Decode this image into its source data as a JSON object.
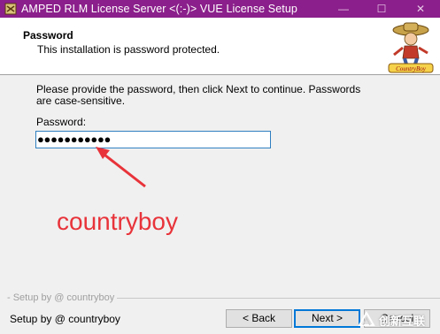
{
  "window": {
    "title": "AMPED RLM License Server <(:-)> VUE License Setup",
    "minimize_glyph": "—",
    "maximize_glyph": "☐",
    "close_glyph": "✕"
  },
  "header": {
    "title": "Password",
    "subtitle": "This installation is password protected.",
    "logo_icon": "countryboy-logo-icon"
  },
  "main": {
    "instructions": "Please provide the password, then click Next to continue. Passwords are case-sensitive.",
    "password_label": "Password:",
    "password_masked": "●●●●●●●●●●●",
    "annotation_text": "countryboy"
  },
  "branding": {
    "text": "- Setup by @ countryboy"
  },
  "footer": {
    "text": "Setup by @ countryboy",
    "back_label": "< Back",
    "next_label": "Next >",
    "cancel_label": "Cancel"
  },
  "watermark": {
    "text": "创新互联"
  },
  "colors": {
    "titlebar": "#8b1f8b",
    "annotation": "#e8333a",
    "focus": "#0078d7"
  }
}
